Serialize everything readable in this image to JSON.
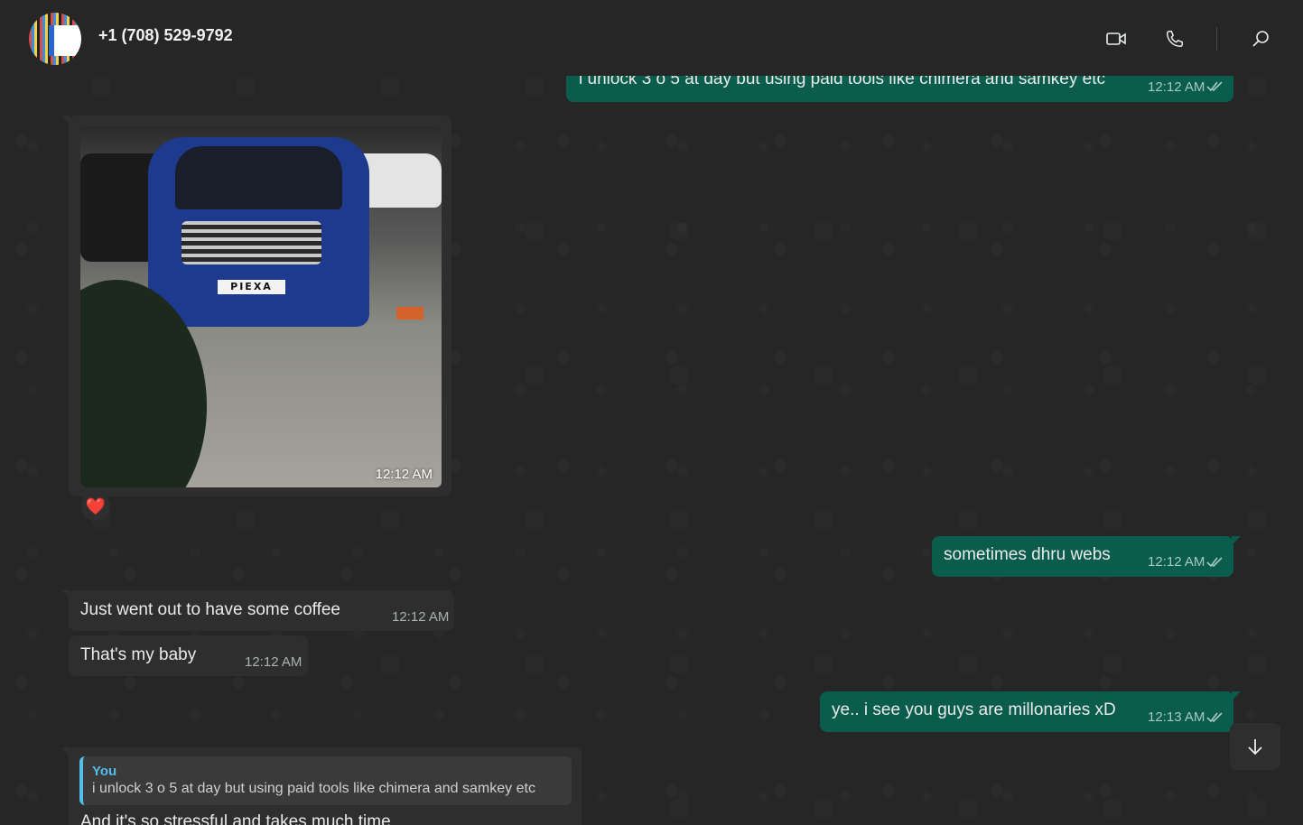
{
  "header": {
    "contact_name": "+1 (708) 529-9792",
    "icons": {
      "video": "video-call-icon",
      "voice": "voice-call-icon",
      "search": "search-icon"
    }
  },
  "messages": [
    {
      "id": "m1",
      "direction": "outgoing",
      "text": "i unlock 3 o 5 at day but using paid tools like chimera and samkey etc",
      "time": "12:12 AM",
      "status": "read"
    },
    {
      "id": "m2",
      "direction": "incoming",
      "type": "image",
      "image_plate_text": "PIEXA",
      "time": "12:12 AM",
      "reaction": "❤️"
    },
    {
      "id": "m3",
      "direction": "outgoing",
      "text": "sometimes dhru webs",
      "time": "12:12 AM",
      "status": "read"
    },
    {
      "id": "m4",
      "direction": "incoming",
      "text": "Just went out to have some coffee",
      "time": "12:12 AM"
    },
    {
      "id": "m5",
      "direction": "incoming",
      "text": "That's my baby",
      "time": "12:12 AM"
    },
    {
      "id": "m6",
      "direction": "outgoing",
      "text": "ye.. i see you guys are millonaries xD",
      "time": "12:13 AM",
      "status": "read"
    },
    {
      "id": "m7",
      "direction": "incoming",
      "quote": {
        "author": "You",
        "text": "i unlock 3 o 5 at day but using paid tools like chimera and samkey etc"
      },
      "text": "And it's so stressful and takes much time"
    }
  ],
  "colors": {
    "outgoing_bubble": "#0a5c4c",
    "incoming_bubble": "#2e2e2e",
    "quote_accent": "#53bdeb",
    "read_ticks": "#a6c9c1"
  },
  "scroll_down_icon": "arrow-down-icon"
}
